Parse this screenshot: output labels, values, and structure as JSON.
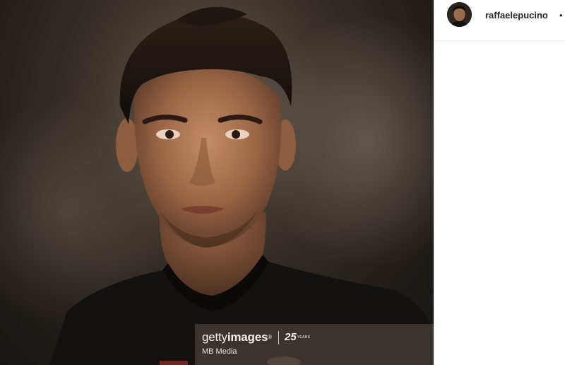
{
  "post": {
    "username": "raffaelepucino",
    "separator": "•"
  },
  "watermark": {
    "brand_regular": "getty",
    "brand_bold": "images",
    "registered": "®",
    "years_number": "25",
    "years_label": "YEARS",
    "credit": "MB Media"
  },
  "colors": {
    "username": "#262626",
    "divider": "#efefef",
    "watermark_bg": "#463e37"
  }
}
